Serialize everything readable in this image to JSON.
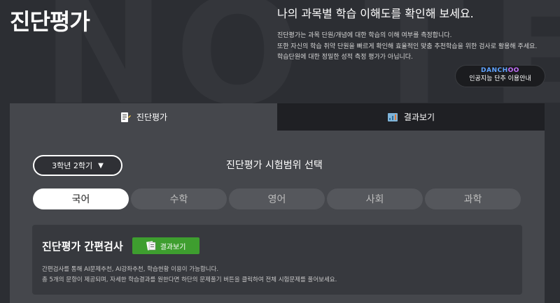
{
  "header": {
    "title": "진단평가",
    "headline": "나의 과목별 학습 이해도를 확인해 보세요.",
    "desc_lines": [
      "진단평가는 과목 단원/개념에 대한 학습의 이해 여부를 측정합니다.",
      "또한 자신의 학습 취약 단원을 빠르게 확인해 효율적인 맞춤 추천학습을 위한 검사로 활용해 주세요.",
      "학습단원에 대한 정밀한 성적 측정 평가가 아닙니다."
    ],
    "danchoo_logo_a": "DANCH",
    "danchoo_logo_b": "OO",
    "danchoo_label": "인공지능 단추 이용안내"
  },
  "tabs": [
    {
      "label": "진단평가",
      "icon": "document-pencil-icon"
    },
    {
      "label": "결과보기",
      "icon": "chart-icon"
    }
  ],
  "grade_select": {
    "value": "3학년 2학기"
  },
  "range_title": "진단평가 시험범위 선택",
  "subjects": [
    "국어",
    "수학",
    "영어",
    "사회",
    "과학"
  ],
  "active_subject": "국어",
  "card": {
    "title": "진단평가 간편검사",
    "button_label": "결과보기",
    "desc_lines": [
      "간편검사를 통해 AI문제추천, AI강좌추천, 학습현황 이용이 가능합니다.",
      "총 5개의 문항이 제공되며, 자세한 학습결과를 원한다면 하단의 문제풀기 버튼을 클릭하여 전체 시험문제를 풀어보세요."
    ]
  },
  "colors": {
    "background": "#2c2e33",
    "panel": "#45474c",
    "button_green": "#3e9e2f"
  }
}
